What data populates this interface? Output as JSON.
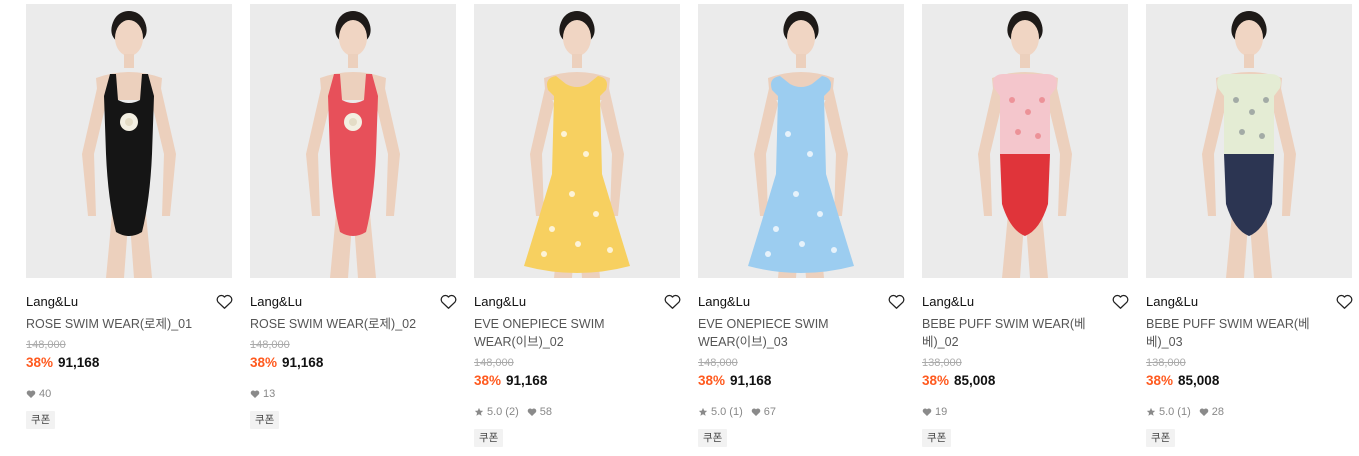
{
  "products": [
    {
      "brand": "Lang&Lu",
      "name": "ROSE SWIM WEAR(로제)_01",
      "original_price": "148,000",
      "discount": "38%",
      "price": "91,168",
      "rating": null,
      "review_count": null,
      "likes": "40",
      "coupon": "쿠폰",
      "swimsuit_color": "#151515",
      "style": "onepiece"
    },
    {
      "brand": "Lang&Lu",
      "name": "ROSE SWIM WEAR(로제)_02",
      "original_price": "148,000",
      "discount": "38%",
      "price": "91,168",
      "rating": null,
      "review_count": null,
      "likes": "13",
      "coupon": "쿠폰",
      "swimsuit_color": "#e7505a",
      "style": "onepiece"
    },
    {
      "brand": "Lang&Lu",
      "name": "EVE ONEPIECE SWIM WEAR(이브)_02",
      "original_price": "148,000",
      "discount": "38%",
      "price": "91,168",
      "rating": "5.0",
      "review_count": "(2)",
      "likes": "58",
      "coupon": "쿠폰",
      "swimsuit_color": "#f7d060",
      "style": "dress"
    },
    {
      "brand": "Lang&Lu",
      "name": "EVE ONEPIECE SWIM WEAR(이브)_03",
      "original_price": "148,000",
      "discount": "38%",
      "price": "91,168",
      "rating": "5.0",
      "review_count": "(1)",
      "likes": "67",
      "coupon": "쿠폰",
      "swimsuit_color": "#9ccdf0",
      "style": "dress"
    },
    {
      "brand": "Lang&Lu",
      "name": "BEBE PUFF SWIM WEAR(베베)_02",
      "original_price": "138,000",
      "discount": "38%",
      "price": "85,008",
      "rating": null,
      "review_count": null,
      "likes": "19",
      "coupon": "쿠폰",
      "swimsuit_color": "#e0343a",
      "top_color": "#f4c6cc",
      "style": "puff"
    },
    {
      "brand": "Lang&Lu",
      "name": "BEBE PUFF SWIM WEAR(베베)_03",
      "original_price": "138,000",
      "discount": "38%",
      "price": "85,008",
      "rating": "5.0",
      "review_count": "(1)",
      "likes": "28",
      "coupon": "쿠폰",
      "swimsuit_color": "#2c3552",
      "top_color": "#e4ecd4",
      "style": "puff"
    }
  ],
  "icons": {
    "wishlist": "heart-outline-icon",
    "like": "heart-filled-icon",
    "rating": "star-icon"
  },
  "colors": {
    "discount": "#ff5a1f",
    "muted": "#888888",
    "coupon_bg": "#f2f2f2"
  }
}
